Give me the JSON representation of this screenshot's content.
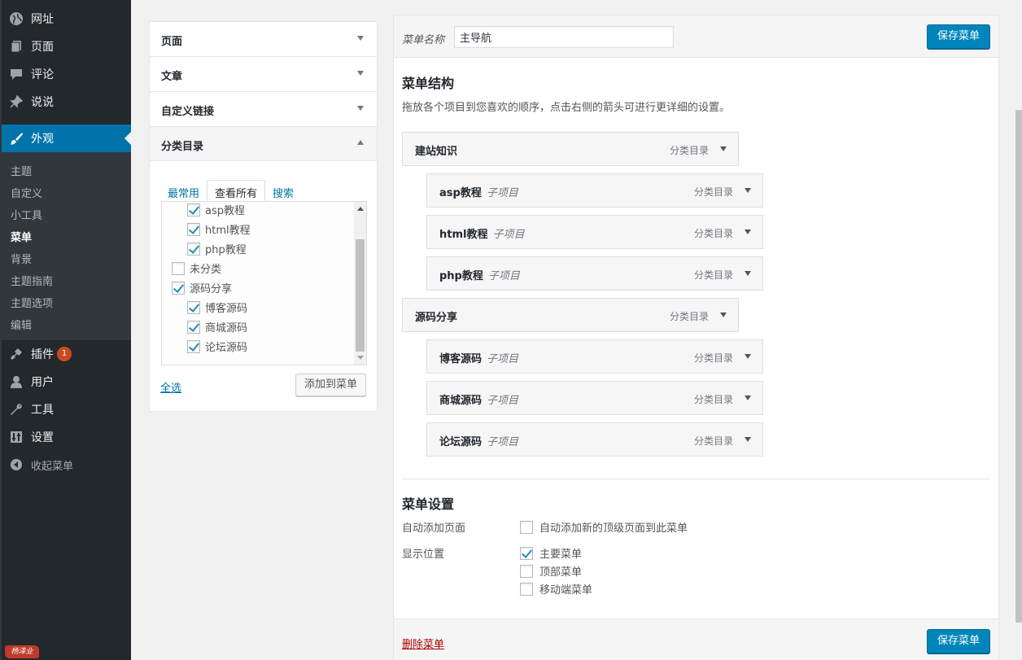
{
  "sidebar": {
    "top_items": [
      {
        "label": "网址",
        "icon": "globe-icon"
      },
      {
        "label": "页面",
        "icon": "pages-icon"
      },
      {
        "label": "评论",
        "icon": "comment-icon"
      },
      {
        "label": "说说",
        "icon": "pin-icon"
      }
    ],
    "active_item": {
      "label": "外观",
      "icon": "paintbrush-icon"
    },
    "submenu": [
      "主题",
      "自定义",
      "小工具",
      "菜单",
      "背景",
      "主题指南",
      "主题选项",
      "编辑"
    ],
    "current_submenu": "菜单",
    "bottom_items": [
      {
        "label": "插件",
        "icon": "plugin-icon",
        "badge": "1"
      },
      {
        "label": "用户",
        "icon": "user-icon"
      },
      {
        "label": "工具",
        "icon": "wrench-icon"
      },
      {
        "label": "设置",
        "icon": "settings-icon"
      }
    ],
    "collapse_label": "收起菜单",
    "logo_text": "杨泽业"
  },
  "left_panel": {
    "accordions": [
      "页面",
      "文章",
      "自定义链接",
      "分类目录"
    ],
    "tabs": [
      "最常用",
      "查看所有",
      "搜索"
    ],
    "active_tab": "查看所有",
    "categories": [
      {
        "label": "asp教程",
        "checked": true,
        "level": 1
      },
      {
        "label": "html教程",
        "checked": true,
        "level": 1
      },
      {
        "label": "php教程",
        "checked": true,
        "level": 1
      },
      {
        "label": "未分类",
        "checked": false,
        "level": 0
      },
      {
        "label": "源码分享",
        "checked": true,
        "level": 0
      },
      {
        "label": "博客源码",
        "checked": true,
        "level": 1
      },
      {
        "label": "商城源码",
        "checked": true,
        "level": 1
      },
      {
        "label": "论坛源码",
        "checked": true,
        "level": 1
      }
    ],
    "select_all": "全选",
    "add_button": "添加到菜单"
  },
  "right_panel": {
    "menu_name_label": "菜单名称",
    "menu_name_value": "主导航",
    "save_label": "保存菜单",
    "structure_title": "菜单结构",
    "structure_desc": "拖放各个项目到您喜欢的顺序，点击右侧的箭头可进行更详细的设置。",
    "items": [
      {
        "name": "建站知识",
        "type": "分类目录",
        "sub": ""
      },
      {
        "name": "asp教程",
        "type": "分类目录",
        "sub": "子项目"
      },
      {
        "name": "html教程",
        "type": "分类目录",
        "sub": "子项目"
      },
      {
        "name": "php教程",
        "type": "分类目录",
        "sub": "子项目"
      },
      {
        "name": "源码分享",
        "type": "分类目录",
        "sub": ""
      },
      {
        "name": "博客源码",
        "type": "分类目录",
        "sub": "子项目"
      },
      {
        "name": "商城源码",
        "type": "分类目录",
        "sub": "子项目"
      },
      {
        "name": "论坛源码",
        "type": "分类目录",
        "sub": "子项目"
      }
    ],
    "settings_title": "菜单设置",
    "auto_add_label": "自动添加页面",
    "auto_add_option": {
      "label": "自动添加新的顶级页面到此菜单",
      "checked": false
    },
    "location_label": "显示位置",
    "locations": [
      {
        "label": "主要菜单",
        "checked": true
      },
      {
        "label": "顶部菜单",
        "checked": false
      },
      {
        "label": "移动端菜单",
        "checked": false
      }
    ],
    "delete_label": "删除菜单"
  }
}
